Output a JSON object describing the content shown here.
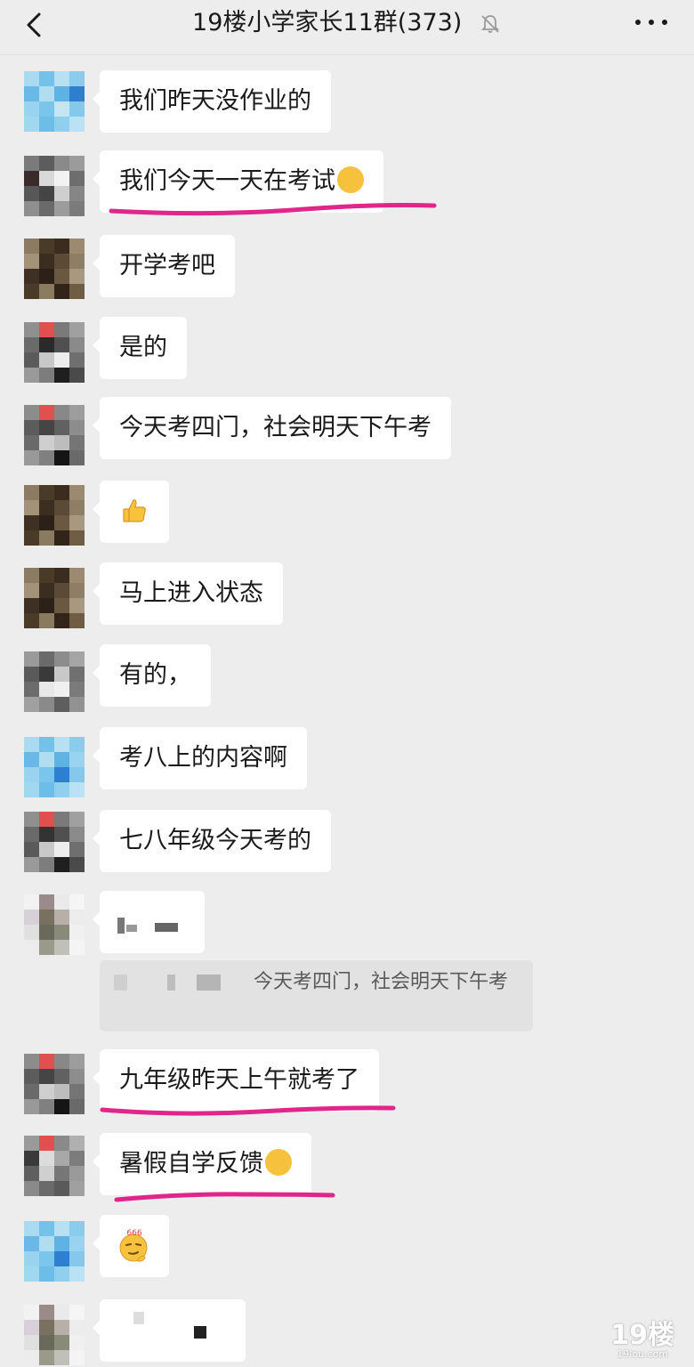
{
  "header": {
    "title": "19楼小学家长11群(373)",
    "back_icon": "chevron-left-icon",
    "mute_icon": "bell-mute-icon",
    "more_icon": "more-dots-icon"
  },
  "messages": [
    {
      "text": "我们昨天没作业的"
    },
    {
      "text": "我们今天一天在考试",
      "emoji": "laughing-crying-face"
    },
    {
      "text": "开学考吧"
    },
    {
      "text": "是的"
    },
    {
      "text": "今天考四门，社会明天下午考"
    },
    {
      "text": "",
      "emoji": "thumbs-up"
    },
    {
      "text": "马上进入状态"
    },
    {
      "text": "有的，"
    },
    {
      "text": "考八上的内容啊"
    },
    {
      "text": "七八年级今天考的"
    },
    {
      "text": "",
      "note": "blurred content"
    },
    {
      "text": "九年级昨天上午就考了"
    },
    {
      "text": "暑假自学反馈",
      "emoji": "tears-of-joy"
    },
    {
      "text": "",
      "emoji": "666-face"
    },
    {
      "text": "",
      "note": "blurred content"
    }
  ],
  "quote": {
    "text": "今天考四门，社会明天下午考"
  },
  "watermark": {
    "big": "19楼",
    "small": "19lou.com"
  },
  "colors": {
    "background": "#ededed",
    "bubble": "#ffffff",
    "underline": "#e0268a"
  }
}
